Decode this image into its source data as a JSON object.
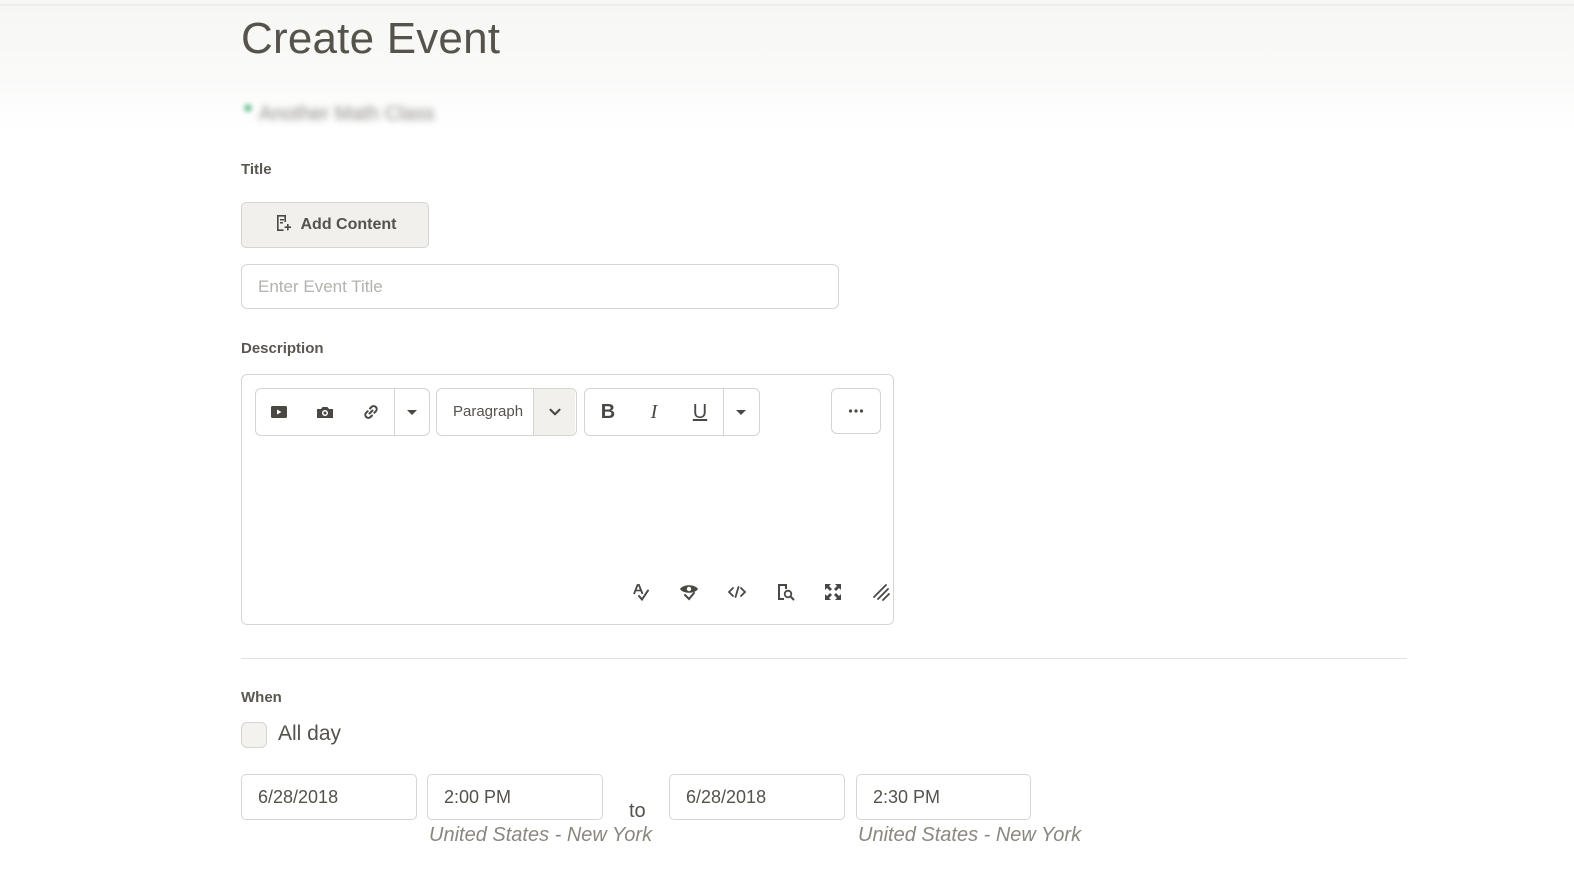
{
  "page": {
    "title": "Create Event",
    "course_name": "Another Math Class"
  },
  "title_section": {
    "label": "Title",
    "add_content_label": "Add Content",
    "input_placeholder": "Enter Event Title",
    "input_value": ""
  },
  "description_section": {
    "label": "Description",
    "toolbar": {
      "insert_group": [
        "video-icon",
        "camera-icon",
        "link-icon",
        "caret-down-icon"
      ],
      "format_select": "Paragraph",
      "text_format": {
        "bold": "B",
        "italic": "I",
        "underline": "U"
      },
      "more": "more-icon"
    },
    "bottom_tools": [
      "spellcheck-icon",
      "accessibility-check-icon",
      "source-code-icon",
      "preview-icon",
      "fullscreen-icon",
      "resize-handle-icon"
    ]
  },
  "when_section": {
    "label": "When",
    "all_day_label": "All day",
    "all_day_checked": false,
    "start_date": "6/28/2018",
    "start_time": "2:00 PM",
    "to_label": "to",
    "end_date": "6/28/2018",
    "end_time": "2:30 PM",
    "start_timezone": "United States - New York",
    "end_timezone": "United States - New York"
  }
}
